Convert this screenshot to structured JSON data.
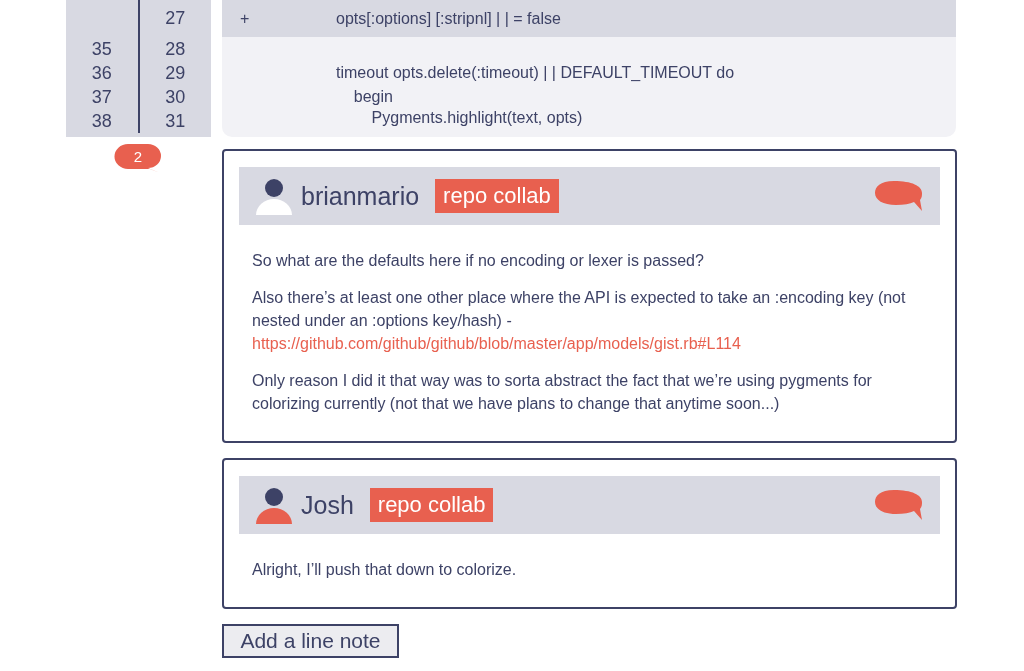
{
  "diff": {
    "rows": [
      {
        "old": "",
        "new": "27",
        "kind": "added",
        "marker": "+",
        "code": "opts[:options] [:stripnl] | | = false"
      },
      {
        "old": "35",
        "new": "28",
        "kind": "context",
        "code": ""
      },
      {
        "old": "36",
        "new": "29",
        "kind": "context",
        "code": "timeout opts.delete(:timeout) | | DEFAULT_TIMEOUT do"
      },
      {
        "old": "37",
        "new": "30",
        "kind": "context",
        "code": "    begin"
      },
      {
        "old": "38",
        "new": "31",
        "kind": "context",
        "code": "        Pygments.highlight(text, opts)"
      }
    ]
  },
  "comment_count": "2",
  "comments": [
    {
      "author": "brianmario",
      "color": "#ffffff",
      "badge": "repo collab",
      "paragraphs": [
        {
          "text": "So what are the defaults here if no encoding or lexer is passed?"
        },
        {
          "text": "Also there’s at least one other place where the API is expected to take an :encoding key (not nested under an :options key/hash) -",
          "link": "https://github.com/github/github/blob/master/app/models/gist.rb#L114"
        },
        {
          "text": "Only reason I did it that way was to sorta abstract the fact that we’re using pygments for colorizing currently (not that we have plans to change that anytime soon...)"
        }
      ]
    },
    {
      "author": "Josh",
      "color": "#e8604f",
      "badge": "repo collab",
      "paragraphs": [
        {
          "text": "Alright, I’ll push that down to colorize."
        }
      ]
    }
  ],
  "add_button": "Add a line note"
}
